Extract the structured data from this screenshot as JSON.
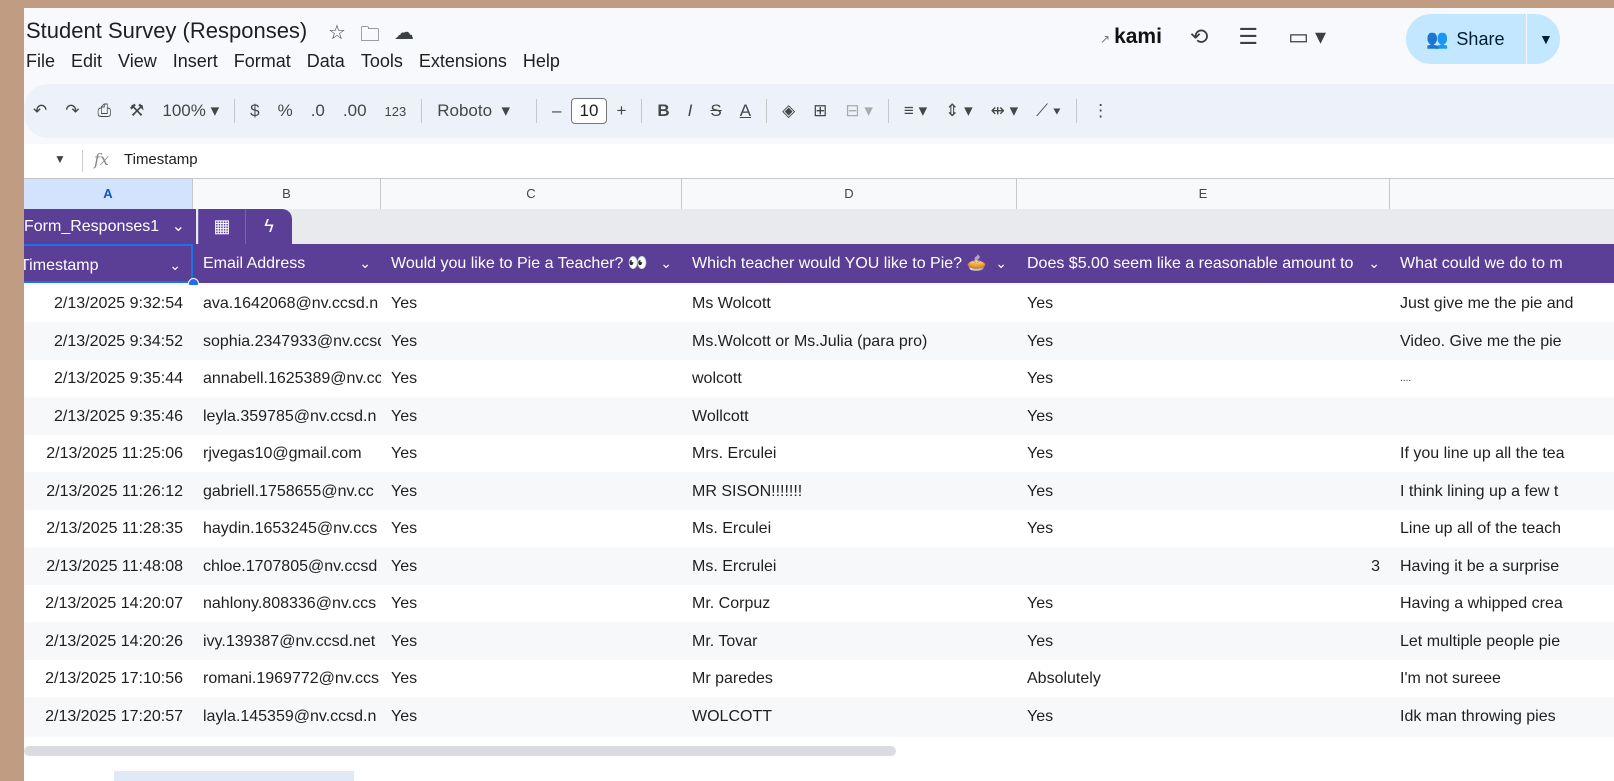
{
  "title": "Student Survey (Responses)",
  "menu": [
    "File",
    "Edit",
    "View",
    "Insert",
    "Format",
    "Data",
    "Tools",
    "Extensions",
    "Help"
  ],
  "header_right": {
    "kami": "kami",
    "share_label": "Share"
  },
  "toolbar": {
    "zoom": "100%",
    "currency": "$",
    "percent": "%",
    "dec_less": ".0",
    "dec_more": ".00",
    "number_format": "123",
    "font": "Roboto",
    "font_size": "10",
    "bold": "B",
    "italic": "I",
    "strike": "S",
    "text_color": "A"
  },
  "formula_bar": {
    "value": "Timestamp"
  },
  "columns": [
    "A",
    "B",
    "C",
    "D",
    "E"
  ],
  "table_name": "Form_Responses1",
  "headers": [
    "Timestamp",
    "Email Address",
    "Would you like to Pie a Teacher? 👀",
    "Which teacher would YOU like to Pie? 🥧",
    "Does $5.00 seem like a reasonable amount to",
    "What could we do to m"
  ],
  "rows": [
    [
      "2/13/2025 9:32:54",
      "ava.1642068@nv.ccsd.n",
      "Yes",
      "Ms Wolcott",
      "Yes",
      "Just give me the pie and"
    ],
    [
      "2/13/2025 9:34:52",
      "sophia.2347933@nv.ccsd",
      "Yes",
      "Ms.Wolcott  or Ms.Julia (para pro)",
      "Yes",
      "Video. Give me the pie"
    ],
    [
      "2/13/2025 9:35:44",
      "annabell.1625389@nv.cc",
      "Yes",
      "wolcott",
      "Yes",
      "...."
    ],
    [
      "2/13/2025 9:35:46",
      "leyla.359785@nv.ccsd.n",
      "Yes",
      "Wollcott",
      "Yes",
      ""
    ],
    [
      "2/13/2025 11:25:06",
      "rjvegas10@gmail.com",
      "Yes",
      "Mrs. Erculei",
      "Yes",
      "If you line up all the tea"
    ],
    [
      "2/13/2025 11:26:12",
      "gabriell.1758655@nv.cc",
      "Yes",
      "MR SISON!!!!!!!",
      "Yes",
      "I think lining up a few t"
    ],
    [
      "2/13/2025 11:28:35",
      "haydin.1653245@nv.ccs",
      "Yes",
      "Ms. Erculei",
      "Yes",
      "Line up all of the teach"
    ],
    [
      "2/13/2025 11:48:08",
      "chloe.1707805@nv.ccsd",
      "Yes",
      "Ms. Ercrulei",
      "3",
      "Having it be a surprise"
    ],
    [
      "2/13/2025 14:20:07",
      "nahlony.808336@nv.ccs",
      "Yes",
      "Mr. Corpuz",
      "Yes",
      "Having a whipped crea"
    ],
    [
      "2/13/2025 14:20:26",
      "ivy.139387@nv.ccsd.net",
      "Yes",
      "Mr. Tovar",
      "Yes",
      "Let multiple people pie"
    ],
    [
      "2/13/2025 17:10:56",
      "romani.1969772@nv.ccs",
      "Yes",
      "Mr paredes",
      "Absolutely",
      "I'm not sureee"
    ],
    [
      "2/13/2025 17:20:57",
      "layla.145359@nv.ccsd.n",
      "Yes",
      "WOLCOTT",
      "Yes",
      "Idk man throwing pies"
    ]
  ],
  "colors": {
    "accent": "#5b3f96",
    "share_bg": "#c2e7ff",
    "selection": "#1a73e8"
  }
}
